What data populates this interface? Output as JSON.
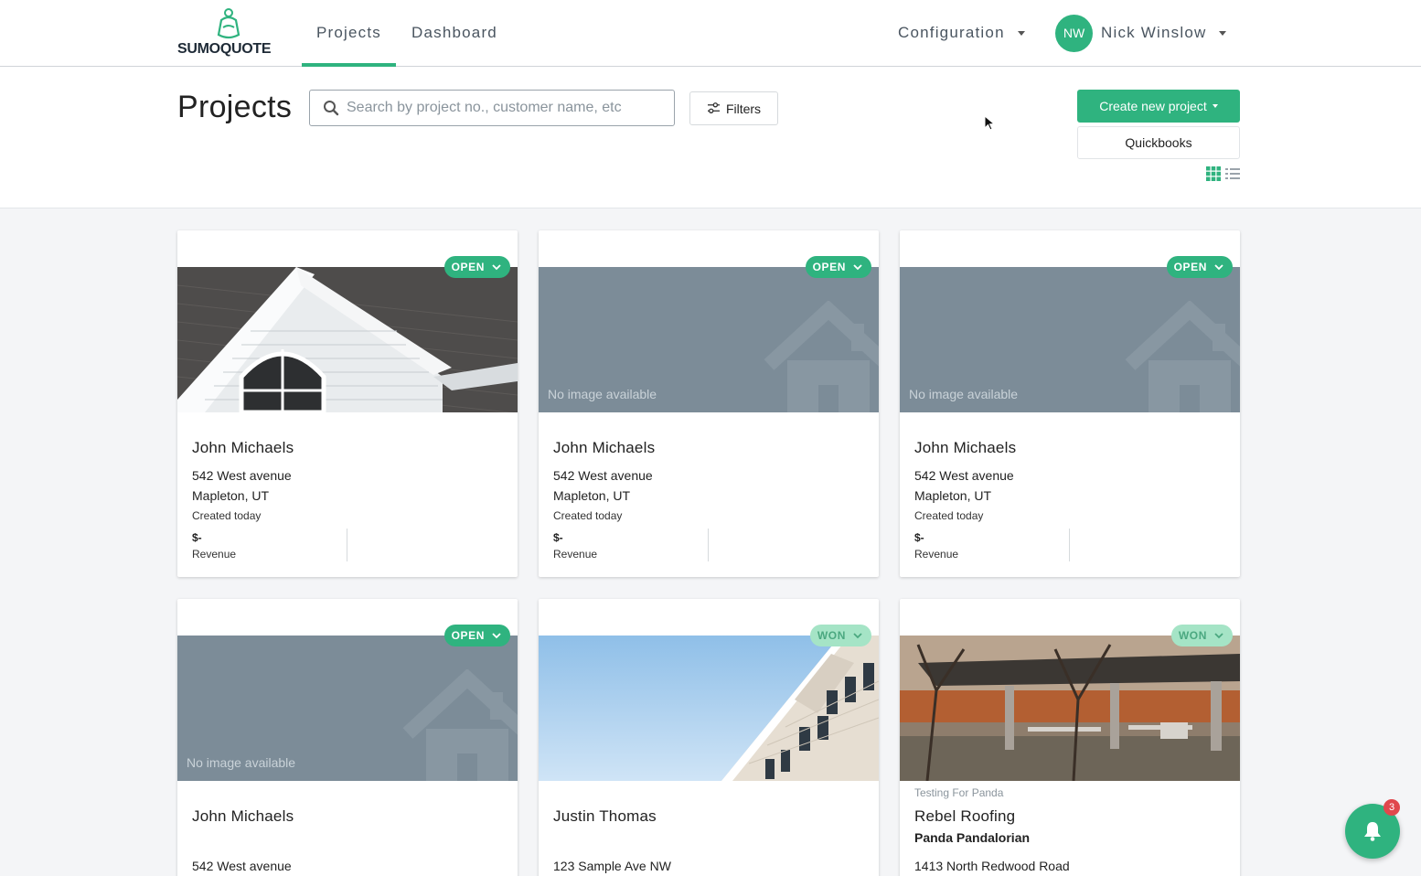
{
  "nav": {
    "logo_text_bold": "SUMO",
    "logo_text_rest": "QUOTE",
    "tabs": [
      {
        "label": "Projects",
        "active": true
      },
      {
        "label": "Dashboard",
        "active": false
      }
    ],
    "configuration_label": "Configuration",
    "user_initials": "NW",
    "user_name": "Nick Winslow"
  },
  "header": {
    "title": "Projects",
    "search_placeholder": "Search by project no., customer name, etc",
    "filters_label": "Filters",
    "create_label": "Create new project",
    "quickbooks_label": "Quickbooks"
  },
  "colors": {
    "accent": "#2fb37f",
    "won_badge_bg": "#a5e4c6",
    "placeholder_image": "#7c8c98",
    "badge_red": "#e0474c"
  },
  "no_image_text": "No image available",
  "cards": [
    {
      "status": "OPEN",
      "image": "house-gable-photo",
      "name": "John Michaels",
      "address1": "542 West avenue",
      "address2": "Mapleton, UT",
      "created": "Created today",
      "revenue_value": "$-",
      "revenue_label": "Revenue"
    },
    {
      "status": "OPEN",
      "image": "none",
      "name": "John Michaels",
      "address1": "542 West avenue",
      "address2": "Mapleton, UT",
      "created": "Created today",
      "revenue_value": "$-",
      "revenue_label": "Revenue"
    },
    {
      "status": "OPEN",
      "image": "none",
      "name": "John Michaels",
      "address1": "542 West avenue",
      "address2": "Mapleton, UT",
      "created": "Created today",
      "revenue_value": "$-",
      "revenue_label": "Revenue"
    },
    {
      "status": "OPEN",
      "image": "none",
      "name": "John Michaels",
      "address1": "542 West avenue"
    },
    {
      "status": "WON",
      "image": "apartment-photo",
      "name": "Justin Thomas",
      "address1": "123 Sample Ave NW"
    },
    {
      "status": "WON",
      "image": "pavilion-photo",
      "subtitle": "Testing For Panda",
      "name": "Rebel Roofing",
      "contact": "Panda Pandalorian",
      "address1": "1413 North Redwood Road"
    }
  ],
  "notifications": {
    "count": "3",
    "icon": "bell-icon"
  }
}
